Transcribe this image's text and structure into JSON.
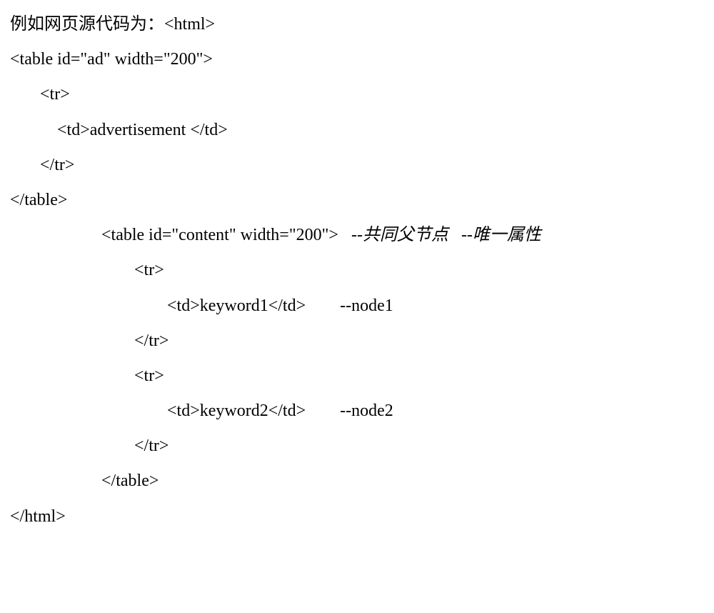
{
  "lines": {
    "l1_prefix": "例如网页源代码为：",
    "l1_code": "<html>",
    "l2": "<table id=\"ad\" width=\"200\">",
    "l3": "<tr>",
    "l4": "<td>advertisement </td>",
    "l5": "</tr>",
    "l6": "</table>",
    "l7_code": "<table id=\"content\" width=\"200\">",
    "l7_comment1": "--共同父节点",
    "l7_comment2": "--唯一属性",
    "l8": "<tr>",
    "l9_code": "<td>keyword1</td>",
    "l9_comment": "--node1",
    "l10": "</tr>",
    "l11": "<tr>",
    "l12_code": "<td>keyword2</td>",
    "l12_comment": "--node2",
    "l13": "</tr>",
    "l14": "</table>",
    "l15": "</html>"
  }
}
